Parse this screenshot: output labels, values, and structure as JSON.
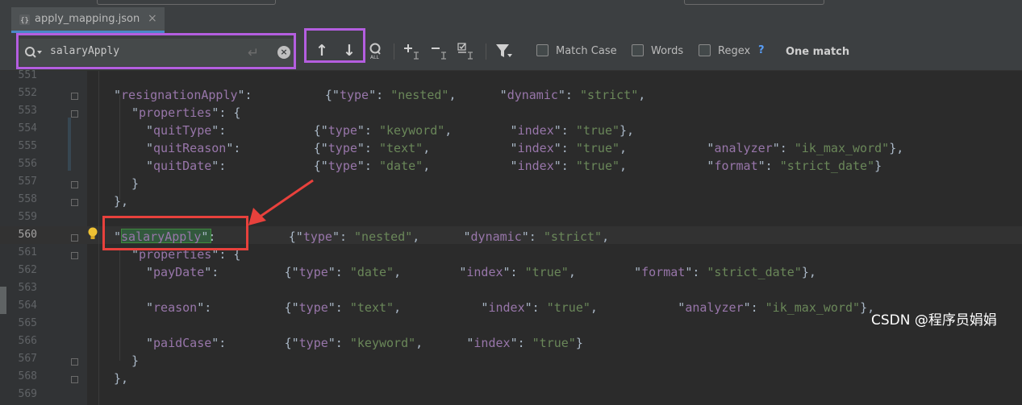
{
  "tab": {
    "filename": "apply_mapping.json",
    "close_glyph": "×"
  },
  "find_bar": {
    "query": "salaryApply",
    "prev_glyph": "↑",
    "next_glyph": "↓",
    "options": [
      {
        "label": "Match Case",
        "checked": false
      },
      {
        "label": "Words",
        "checked": false
      },
      {
        "label": "Regex",
        "checked": false
      }
    ],
    "help_glyph": "?",
    "status": "One match"
  },
  "editor": {
    "line_numbers": [
      "551",
      "552",
      "553",
      "554",
      "555",
      "556",
      "557",
      "558",
      "559",
      "560",
      "561",
      "562",
      "563",
      "564",
      "565",
      "566",
      "567",
      "568",
      "569"
    ],
    "current_line": "560",
    "lines": [
      [],
      [
        [
          "p",
          "\""
        ],
        [
          "k",
          "resignationApply"
        ],
        [
          "p",
          "\":          {\""
        ],
        [
          "k",
          "type"
        ],
        [
          "p",
          "\": "
        ],
        [
          "s",
          "\"nested\""
        ],
        [
          "p",
          ",      \""
        ],
        [
          "k",
          "dynamic"
        ],
        [
          "p",
          "\": "
        ],
        [
          "s",
          "\"strict\""
        ],
        [
          "p",
          ","
        ]
      ],
      [
        [
          "p",
          "\""
        ],
        [
          "k",
          "properties"
        ],
        [
          "p",
          "\": {"
        ]
      ],
      [
        [
          "p",
          "\""
        ],
        [
          "k",
          "quitType"
        ],
        [
          "p",
          "\":            {\""
        ],
        [
          "k",
          "type"
        ],
        [
          "p",
          "\": "
        ],
        [
          "s",
          "\"keyword\""
        ],
        [
          "p",
          ",        \""
        ],
        [
          "k",
          "index"
        ],
        [
          "p",
          "\": "
        ],
        [
          "s",
          "\"true\""
        ],
        [
          "p",
          "},"
        ]
      ],
      [
        [
          "p",
          "\""
        ],
        [
          "k",
          "quitReason"
        ],
        [
          "p",
          "\":          {\""
        ],
        [
          "k",
          "type"
        ],
        [
          "p",
          "\": "
        ],
        [
          "s",
          "\"text\""
        ],
        [
          "p",
          ",           \""
        ],
        [
          "k",
          "index"
        ],
        [
          "p",
          "\": "
        ],
        [
          "s",
          "\"true\""
        ],
        [
          "p",
          ",           \""
        ],
        [
          "k",
          "analyzer"
        ],
        [
          "p",
          "\": "
        ],
        [
          "s",
          "\"ik_max_word\""
        ],
        [
          "p",
          "},"
        ]
      ],
      [
        [
          "p",
          "\""
        ],
        [
          "k",
          "quitDate"
        ],
        [
          "p",
          "\":            {\""
        ],
        [
          "k",
          "type"
        ],
        [
          "p",
          "\": "
        ],
        [
          "s",
          "\"date\""
        ],
        [
          "p",
          ",           \""
        ],
        [
          "k",
          "index"
        ],
        [
          "p",
          "\": "
        ],
        [
          "s",
          "\"true\""
        ],
        [
          "p",
          ",           \""
        ],
        [
          "k",
          "format"
        ],
        [
          "p",
          "\": "
        ],
        [
          "s",
          "\"strict_date\""
        ],
        [
          "p",
          "}"
        ]
      ],
      [
        [
          "p",
          "}"
        ]
      ],
      [
        [
          "p",
          "},"
        ]
      ],
      [],
      [
        [
          "p",
          "\""
        ],
        [
          "k",
          "salaryApply"
        ],
        [
          "p",
          "\":          {\""
        ],
        [
          "k",
          "type"
        ],
        [
          "p",
          "\": "
        ],
        [
          "s",
          "\"nested\""
        ],
        [
          "p",
          ",      \""
        ],
        [
          "k",
          "dynamic"
        ],
        [
          "p",
          "\": "
        ],
        [
          "s",
          "\"strict\""
        ],
        [
          "p",
          ","
        ]
      ],
      [
        [
          "p",
          "\""
        ],
        [
          "k",
          "properties"
        ],
        [
          "p",
          "\": {"
        ]
      ],
      [
        [
          "p",
          "\""
        ],
        [
          "k",
          "payDate"
        ],
        [
          "p",
          "\":         {\""
        ],
        [
          "k",
          "type"
        ],
        [
          "p",
          "\": "
        ],
        [
          "s",
          "\"date\""
        ],
        [
          "p",
          ",        \""
        ],
        [
          "k",
          "index"
        ],
        [
          "p",
          "\": "
        ],
        [
          "s",
          "\"true\""
        ],
        [
          "p",
          ",        \""
        ],
        [
          "k",
          "format"
        ],
        [
          "p",
          "\": "
        ],
        [
          "s",
          "\"strict_date\""
        ],
        [
          "p",
          "},"
        ]
      ],
      [],
      [
        [
          "p",
          "\""
        ],
        [
          "k",
          "reason"
        ],
        [
          "p",
          "\":          {\""
        ],
        [
          "k",
          "type"
        ],
        [
          "p",
          "\": "
        ],
        [
          "s",
          "\"text\""
        ],
        [
          "p",
          ",           \""
        ],
        [
          "k",
          "index"
        ],
        [
          "p",
          "\": "
        ],
        [
          "s",
          "\"true\""
        ],
        [
          "p",
          ",           \""
        ],
        [
          "k",
          "analyzer"
        ],
        [
          "p",
          "\": "
        ],
        [
          "s",
          "\"ik_max_word\""
        ],
        [
          "p",
          "},"
        ]
      ],
      [],
      [
        [
          "p",
          "\""
        ],
        [
          "k",
          "paidCase"
        ],
        [
          "p",
          "\":        {\""
        ],
        [
          "k",
          "type"
        ],
        [
          "p",
          "\": "
        ],
        [
          "s",
          "\"keyword\""
        ],
        [
          "p",
          ",      \""
        ],
        [
          "k",
          "index"
        ],
        [
          "p",
          "\": "
        ],
        [
          "s",
          "\"true\""
        ],
        [
          "p",
          "}"
        ]
      ],
      [
        [
          "p",
          "}"
        ]
      ],
      [
        [
          "p",
          "},"
        ]
      ],
      []
    ]
  },
  "watermark": "CSDN @程序员娟娟",
  "colors": {
    "accent": "#4a88c7",
    "annotation_purple": "#b45ee0",
    "annotation_red": "#e8413c",
    "match_fill": "#32593d"
  }
}
